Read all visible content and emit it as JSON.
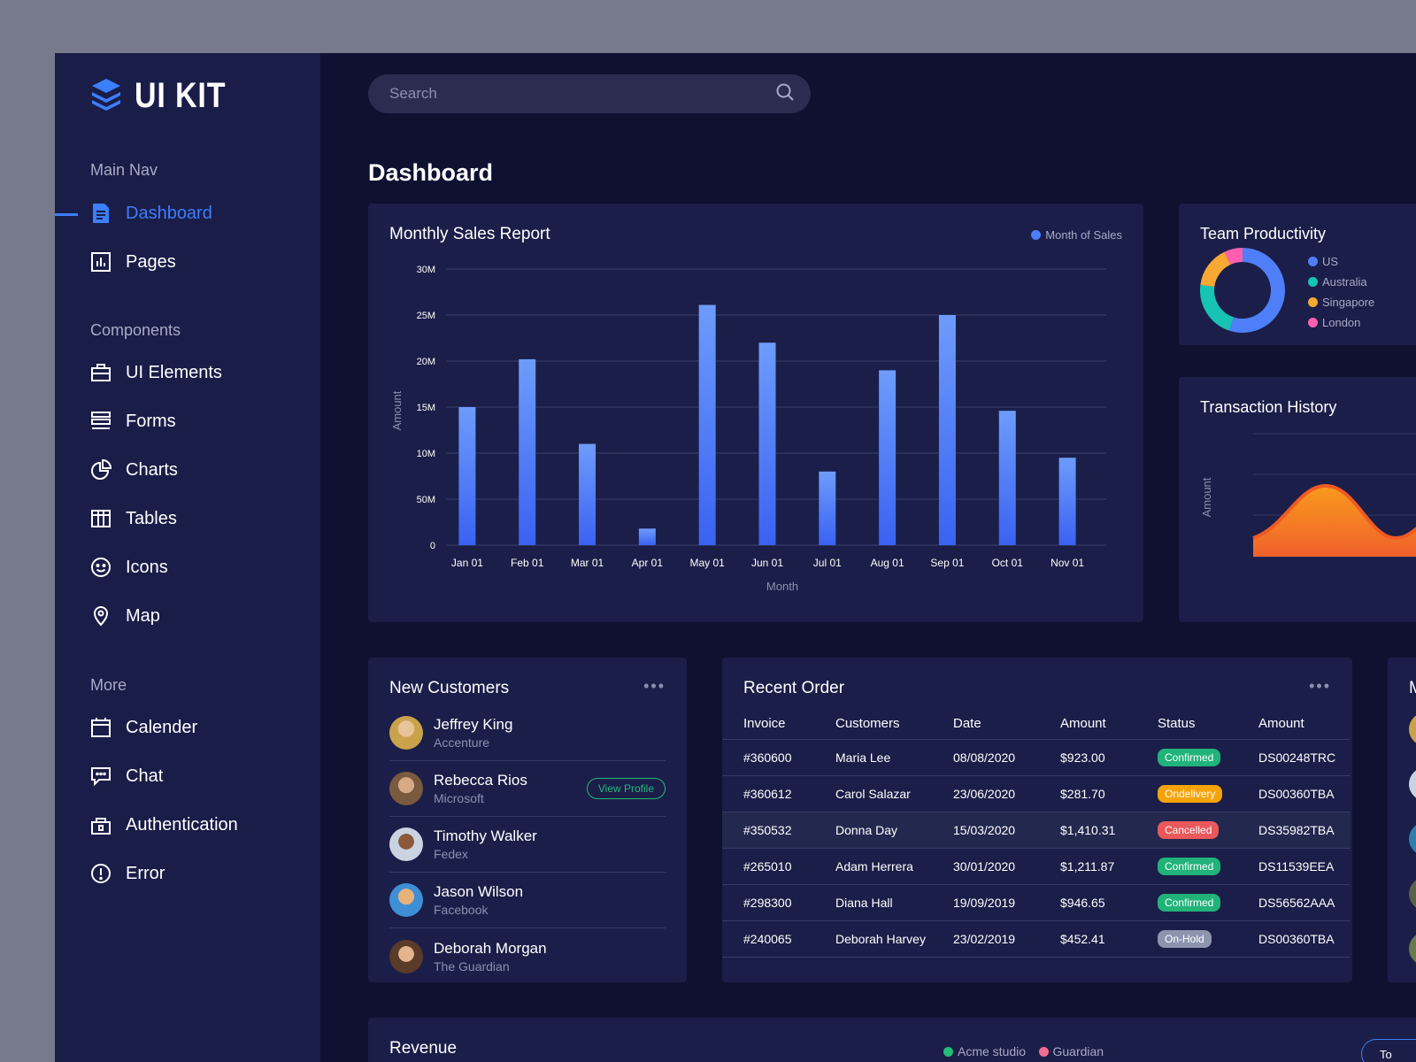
{
  "brand": {
    "name": "UI KIT",
    "color": "#3c7ffa"
  },
  "search": {
    "placeholder": "Search"
  },
  "page": {
    "title": "Dashboard"
  },
  "sidebar": {
    "sections": [
      {
        "label": "Main Nav",
        "items": [
          {
            "label": "Dashboard",
            "icon": "document-icon",
            "active": true
          },
          {
            "label": "Pages",
            "icon": "bar-chart-icon"
          }
        ]
      },
      {
        "label": "Components",
        "items": [
          {
            "label": "UI Elements",
            "icon": "briefcase-icon"
          },
          {
            "label": "Forms",
            "icon": "forms-icon"
          },
          {
            "label": "Charts",
            "icon": "pie-chart-icon"
          },
          {
            "label": "Tables",
            "icon": "table-icon"
          },
          {
            "label": "Icons",
            "icon": "smiley-icon"
          },
          {
            "label": "Map",
            "icon": "map-pin-icon"
          }
        ]
      },
      {
        "label": "More",
        "items": [
          {
            "label": "Calender",
            "icon": "calendar-icon"
          },
          {
            "label": "Chat",
            "icon": "chat-icon"
          },
          {
            "label": "Authentication",
            "icon": "lock-icon"
          },
          {
            "label": "Error",
            "icon": "error-icon"
          }
        ]
      }
    ]
  },
  "sales": {
    "title": "Monthly Sales Report",
    "chart_data": {
      "type": "bar",
      "categories": [
        "Jan 01",
        "Feb 01",
        "Mar 01",
        "Apr 01",
        "May 01",
        "Jun 01",
        "Jul 01",
        "Aug 01",
        "Sep 01",
        "Oct 01",
        "Nov 01"
      ],
      "series": [
        {
          "name": "Month of Sales",
          "values": [
            15,
            20.2,
            11,
            1.8,
            26.1,
            22,
            8,
            19,
            25,
            14.6,
            9.5
          ]
        }
      ],
      "ytick_labels": [
        "0",
        "50M",
        "10M",
        "15M",
        "20M",
        "25M",
        "30M"
      ],
      "ytick_values": [
        0,
        5,
        10,
        15,
        20,
        25,
        30
      ],
      "ylim": [
        0,
        30
      ],
      "xlabel": "Month",
      "ylabel": "Amount",
      "grid": true,
      "legend": "top-right",
      "color": "#3d6cf6"
    }
  },
  "productivity": {
    "title": "Team Productivity",
    "chart_data": {
      "type": "pie",
      "labels": [
        "US",
        "Australia",
        "Singapore",
        "London"
      ],
      "values": [
        55,
        22,
        16,
        7
      ],
      "colors": [
        "#4f7ff8",
        "#17c3b2",
        "#f8a933",
        "#ff5fae"
      ],
      "legend": "right"
    }
  },
  "transactions": {
    "title": "Transaction History",
    "chart_data": {
      "type": "area",
      "ylabel": "Amount",
      "values": [
        2,
        8,
        2
      ],
      "color": "#f57a20"
    }
  },
  "customers": {
    "title": "New Customers",
    "view_label": "View Profile",
    "items": [
      {
        "name": "Jeffrey King",
        "company": "Accenture",
        "avatar_color": "#c9a24b"
      },
      {
        "name": "Rebecca Rios",
        "company": "Microsoft",
        "avatar_color": "#7a5a3e"
      },
      {
        "name": "Timothy Walker",
        "company": "Fedex",
        "avatar_color": "#5d6f88"
      },
      {
        "name": "Jason Wilson",
        "company": "Facebook",
        "avatar_color": "#c58b55"
      },
      {
        "name": "Deborah Morgan",
        "company": "The Guardian",
        "avatar_color": "#8d5f43"
      }
    ]
  },
  "orders": {
    "title": "Recent Order",
    "columns": [
      "Invoice",
      "Customers",
      "Date",
      "Amount",
      "Status",
      "Amount"
    ],
    "rows": [
      {
        "invoice": "#360600",
        "customer": "Maria Lee",
        "date": "08/08/2020",
        "amount": "$923.00",
        "status": "Confirmed",
        "status_color": "#21b37a",
        "code": "DS00248TRC"
      },
      {
        "invoice": "#360612",
        "customer": "Carol Salazar",
        "date": "23/06/2020",
        "amount": "$281.70",
        "status": "Ondelivery",
        "status_color": "#f6a30a",
        "code": "DS00360TBA"
      },
      {
        "invoice": "#350532",
        "customer": "Donna Day",
        "date": "15/03/2020",
        "amount": "$1,410.31",
        "status": "Cancelled",
        "status_color": "#e9585a",
        "code": "DS35982TBA"
      },
      {
        "invoice": "#265010",
        "customer": "Adam Herrera",
        "date": "30/01/2020",
        "amount": "$1,211.87",
        "status": "Confirmed",
        "status_color": "#21b37a",
        "code": "DS11539EEA"
      },
      {
        "invoice": "#298300",
        "customer": "Diana Hall",
        "date": "19/09/2019",
        "amount": "$946.65",
        "status": "Confirmed",
        "status_color": "#21b37a",
        "code": "DS56562AAA"
      },
      {
        "invoice": "#240065",
        "customer": "Deborah Harvey",
        "date": "23/02/2019",
        "amount": "$452.41",
        "status": "On-Hold",
        "status_color": "#8c94ae",
        "code": "DS00360TBA"
      }
    ]
  },
  "revenue": {
    "title": "Revenue",
    "legend": [
      {
        "label": "Acme studio",
        "color": "#22c07a"
      },
      {
        "label": "Guardian",
        "color": "#f46d93"
      }
    ],
    "button_label": "To"
  }
}
